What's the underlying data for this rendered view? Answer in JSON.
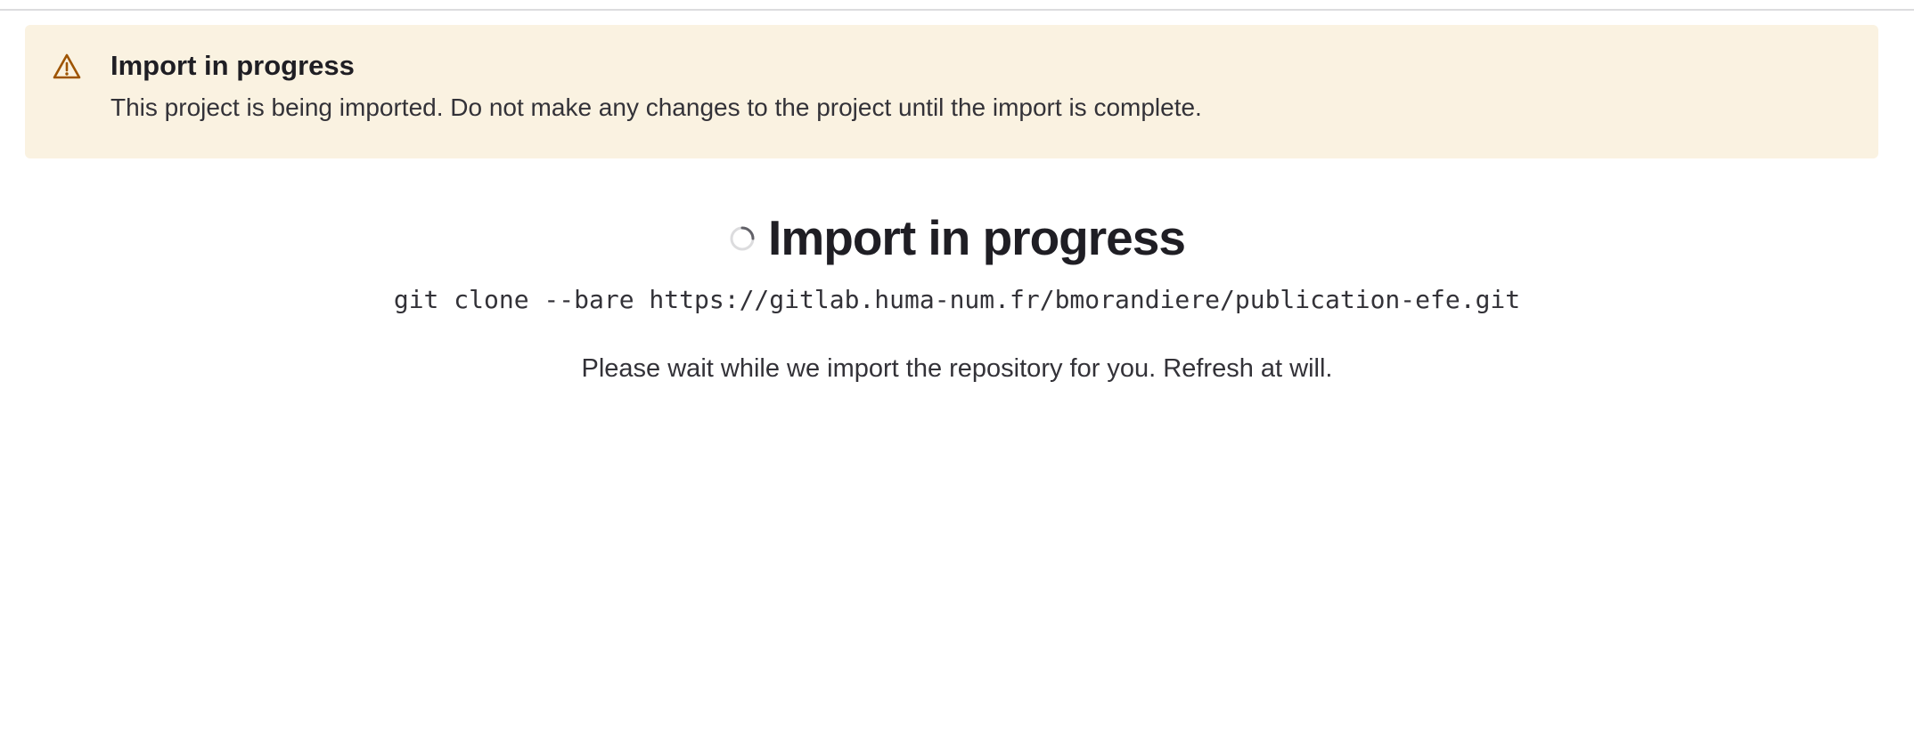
{
  "colors": {
    "alert_background": "#faf2e1",
    "warning_icon": "#9e5400",
    "heading_text": "#1f1e24",
    "body_text": "#333238",
    "spinner_track": "#dcdcde",
    "spinner_arc": "#626168"
  },
  "alert": {
    "icon": "warning-icon",
    "title": "Import in progress",
    "message": "This project is being imported. Do not make any changes to the project until the import is complete."
  },
  "main": {
    "spinner_icon": "loading-spinner-icon",
    "title": "Import in progress",
    "clone_command": "git clone --bare https://gitlab.huma-num.fr/bmorandiere/publication-efe.git",
    "wait_message": "Please wait while we import the repository for you. Refresh at will."
  }
}
